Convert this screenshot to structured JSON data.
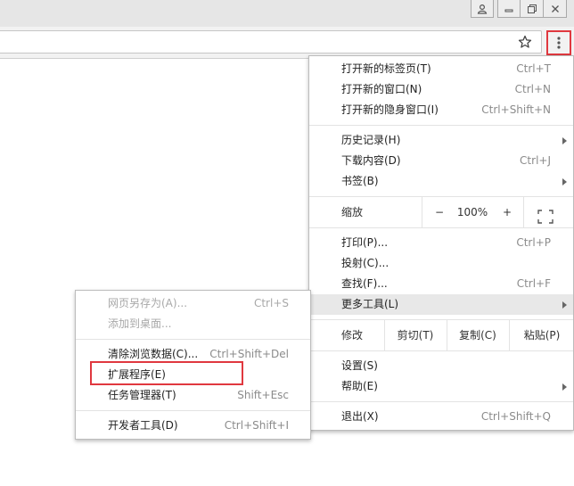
{
  "main_menu": {
    "items_group1": [
      {
        "label": "打开新的标签页(T)",
        "shortcut": "Ctrl+T"
      },
      {
        "label": "打开新的窗口(N)",
        "shortcut": "Ctrl+N"
      },
      {
        "label": "打开新的隐身窗口(I)",
        "shortcut": "Ctrl+Shift+N"
      }
    ],
    "items_group2": [
      {
        "label": "历史记录(H)",
        "shortcut": ""
      },
      {
        "label": "下载内容(D)",
        "shortcut": "Ctrl+J"
      },
      {
        "label": "书签(B)",
        "shortcut": ""
      }
    ],
    "zoom": {
      "label": "缩放",
      "minus": "−",
      "value": "100%",
      "plus": "+"
    },
    "items_group3": [
      {
        "label": "打印(P)...",
        "shortcut": "Ctrl+P"
      },
      {
        "label": "投射(C)...",
        "shortcut": ""
      },
      {
        "label": "查找(F)...",
        "shortcut": "Ctrl+F"
      },
      {
        "label": "更多工具(L)",
        "shortcut": ""
      }
    ],
    "edit": {
      "label": "修改",
      "cut": "剪切(T)",
      "copy": "复制(C)",
      "paste": "粘贴(P)"
    },
    "items_group4": [
      {
        "label": "设置(S)",
        "shortcut": ""
      },
      {
        "label": "帮助(E)",
        "shortcut": ""
      }
    ],
    "exit": {
      "label": "退出(X)",
      "shortcut": "Ctrl+Shift+Q"
    }
  },
  "submenu": {
    "group1": [
      {
        "label": "网页另存为(A)...",
        "shortcut": "Ctrl+S"
      },
      {
        "label": "添加到桌面...",
        "shortcut": ""
      }
    ],
    "group2": [
      {
        "label": "清除浏览数据(C)...",
        "shortcut": "Ctrl+Shift+Del"
      },
      {
        "label": "扩展程序(E)",
        "shortcut": ""
      },
      {
        "label": "任务管理器(T)",
        "shortcut": "Shift+Esc"
      }
    ],
    "group3": [
      {
        "label": "开发者工具(D)",
        "shortcut": "Ctrl+Shift+I"
      }
    ]
  },
  "colors": {
    "highlight_box": "#e0383f",
    "hover_row": "#e8e8e8"
  }
}
